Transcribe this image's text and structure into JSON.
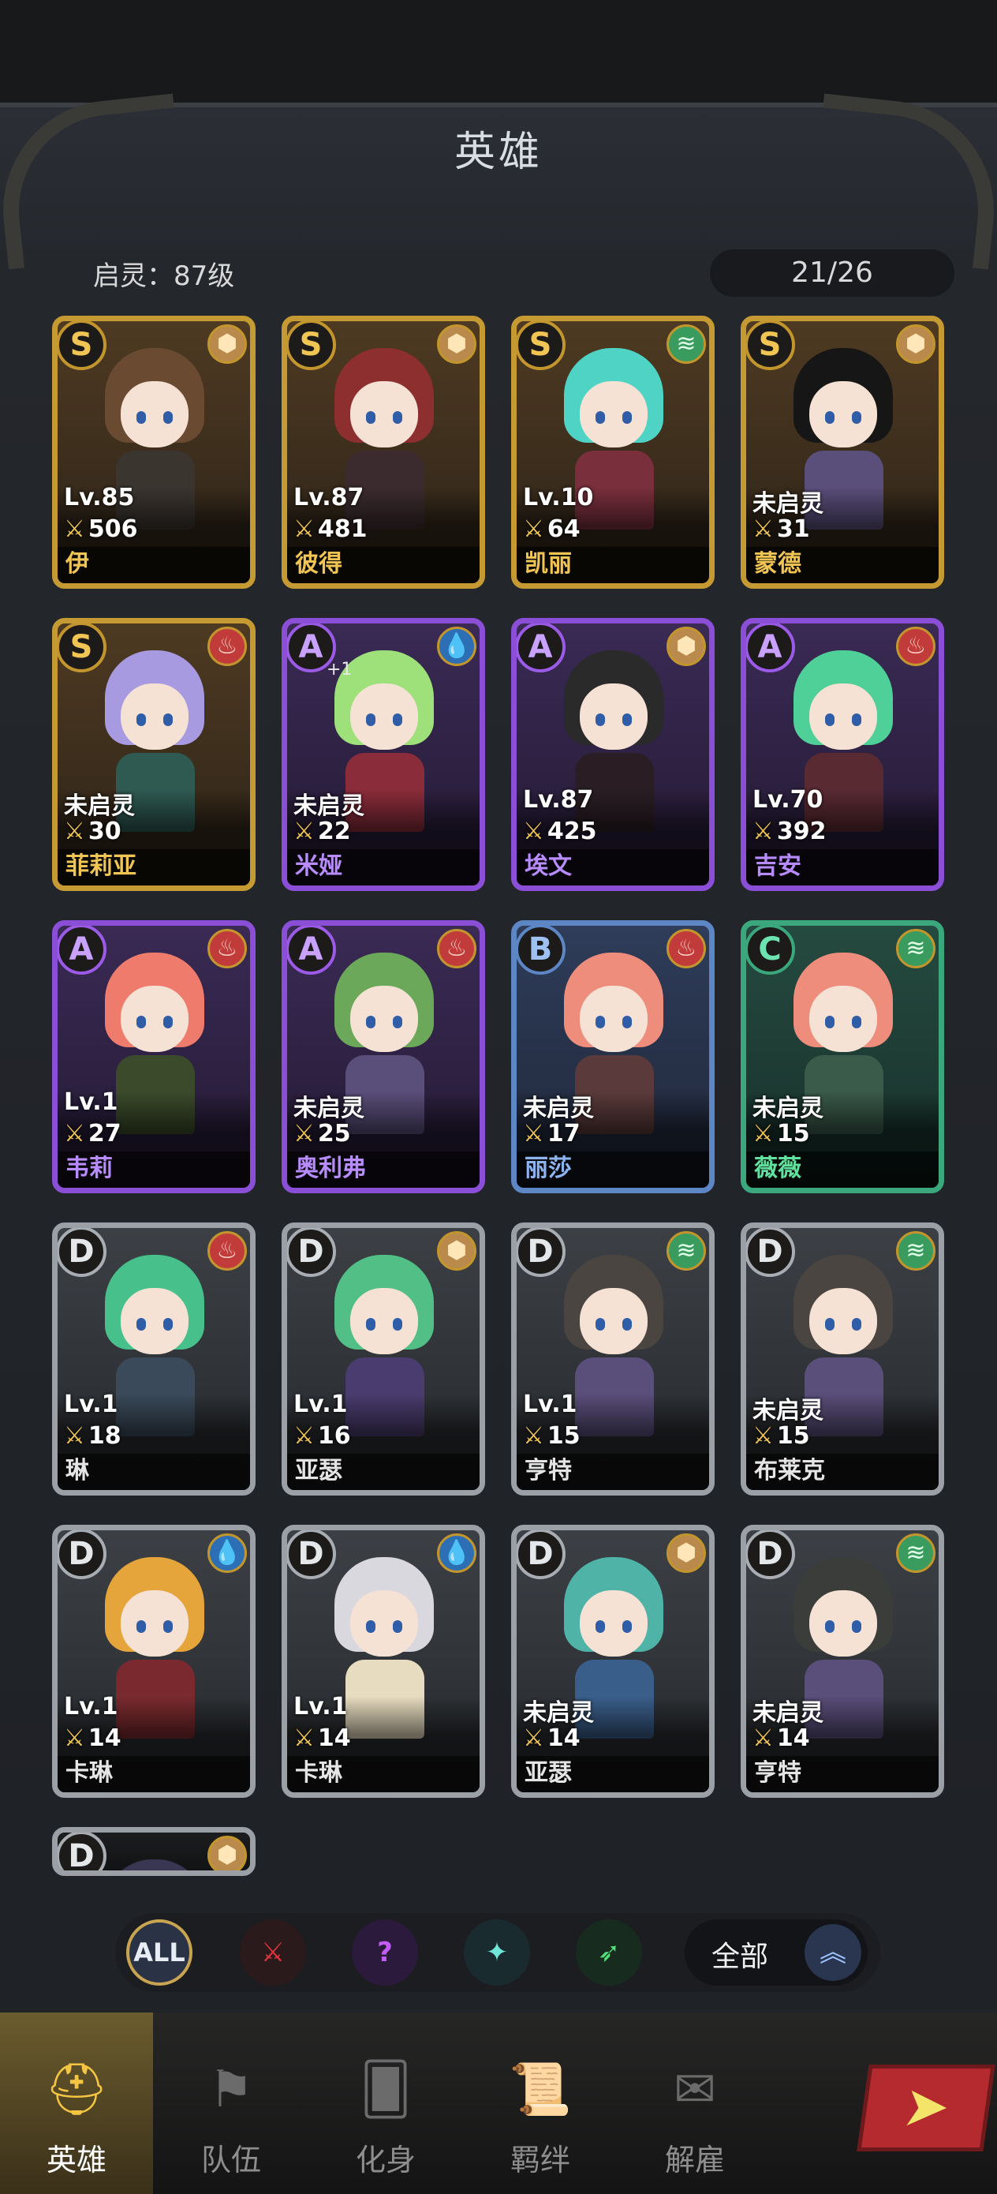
{
  "header": {
    "title": "英雄",
    "qiling_label": "启灵：87级",
    "hero_count": "21/26"
  },
  "heroes": [
    {
      "grade": "S",
      "element": "earth",
      "level": "Lv.85",
      "power": "506",
      "name": "伊"
    },
    {
      "grade": "S",
      "element": "earth",
      "level": "Lv.87",
      "power": "481",
      "name": "彼得"
    },
    {
      "grade": "S",
      "element": "wind",
      "level": "Lv.10",
      "power": "64",
      "name": "凯丽"
    },
    {
      "grade": "S",
      "element": "earth",
      "level": "未启灵",
      "power": "31",
      "name": "蒙德"
    },
    {
      "grade": "S",
      "element": "fire",
      "level": "未启灵",
      "power": "30",
      "name": "菲莉亚"
    },
    {
      "grade": "A",
      "element": "water",
      "level": "未启灵",
      "power": "22",
      "name": "米娅",
      "plus": "+1"
    },
    {
      "grade": "A",
      "element": "earth",
      "level": "Lv.87",
      "power": "425",
      "name": "埃文"
    },
    {
      "grade": "A",
      "element": "fire",
      "level": "Lv.70",
      "power": "392",
      "name": "吉安"
    },
    {
      "grade": "A",
      "element": "fire",
      "level": "Lv.1",
      "power": "27",
      "name": "韦莉"
    },
    {
      "grade": "A",
      "element": "fire",
      "level": "未启灵",
      "power": "25",
      "name": "奥利弗"
    },
    {
      "grade": "B",
      "element": "fire",
      "level": "未启灵",
      "power": "17",
      "name": "丽莎"
    },
    {
      "grade": "C",
      "element": "wind",
      "level": "未启灵",
      "power": "15",
      "name": "薇薇"
    },
    {
      "grade": "D",
      "element": "fire",
      "level": "Lv.1",
      "power": "18",
      "name": "琳"
    },
    {
      "grade": "D",
      "element": "earth",
      "level": "Lv.1",
      "power": "16",
      "name": "亚瑟"
    },
    {
      "grade": "D",
      "element": "wind",
      "level": "Lv.1",
      "power": "15",
      "name": "亨特"
    },
    {
      "grade": "D",
      "element": "wind",
      "level": "未启灵",
      "power": "15",
      "name": "布莱克"
    },
    {
      "grade": "D",
      "element": "water",
      "level": "Lv.1",
      "power": "14",
      "name": "卡琳"
    },
    {
      "grade": "D",
      "element": "water",
      "level": "Lv.1",
      "power": "14",
      "name": "卡琳"
    },
    {
      "grade": "D",
      "element": "earth",
      "level": "未启灵",
      "power": "14",
      "name": "亚瑟"
    },
    {
      "grade": "D",
      "element": "wind",
      "level": "未启灵",
      "power": "14",
      "name": "亨特"
    },
    {
      "grade": "D",
      "element": "earth",
      "level": "",
      "power": "",
      "name": ""
    }
  ],
  "filters": {
    "all_label": "ALL",
    "sort_label": "全部",
    "sort_icon": "chevron-up-double-icon"
  },
  "nav": {
    "items": [
      "英雄",
      "队伍",
      "化身",
      "羁绊",
      "解雇"
    ],
    "active": "英雄"
  },
  "colors": {
    "grade_s": "#c69a32",
    "grade_a": "#8a4fd6",
    "grade_b": "#5d86c4",
    "grade_c": "#3aa77d",
    "grade_d": "#9aa0a6",
    "accent_gold": "#f0c553"
  }
}
